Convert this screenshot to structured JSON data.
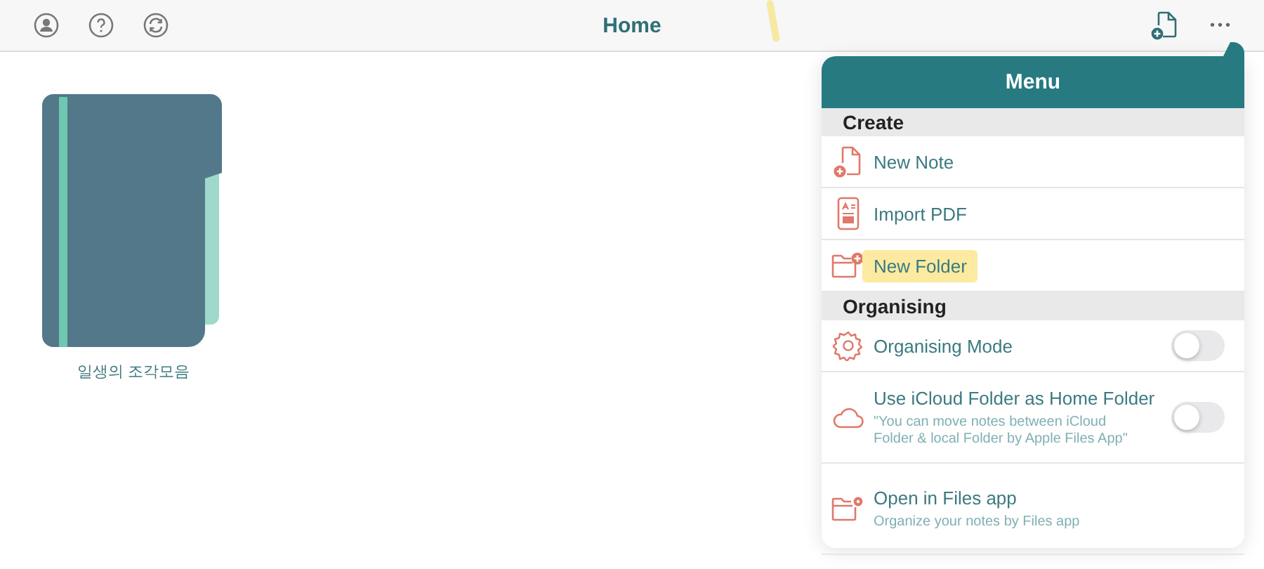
{
  "top_bar": {
    "title": "Home",
    "right_menu_glyph": "•••"
  },
  "folders": [
    {
      "name": "일생의 조각모음"
    }
  ],
  "menu": {
    "title": "Menu",
    "sections": [
      {
        "header": "Create",
        "items": [
          {
            "kind": "action",
            "label": "New Note",
            "highlighted": false
          },
          {
            "kind": "action",
            "label": "Import PDF",
            "highlighted": false
          },
          {
            "kind": "action",
            "label": "New Folder",
            "highlighted": true
          }
        ]
      },
      {
        "header": "Organising",
        "items": [
          {
            "kind": "toggle",
            "label": "Organising Mode",
            "on": false
          },
          {
            "kind": "toggle",
            "label": "Use iCloud Folder as Home Folder",
            "subtitle": "\"You can move notes between iCloud Folder & local Folder by Apple Files App\"",
            "on": false
          },
          {
            "kind": "action",
            "label": "Open in Files app",
            "subtitle": "Organize your notes by Files app",
            "highlighted": false
          }
        ]
      }
    ]
  }
}
